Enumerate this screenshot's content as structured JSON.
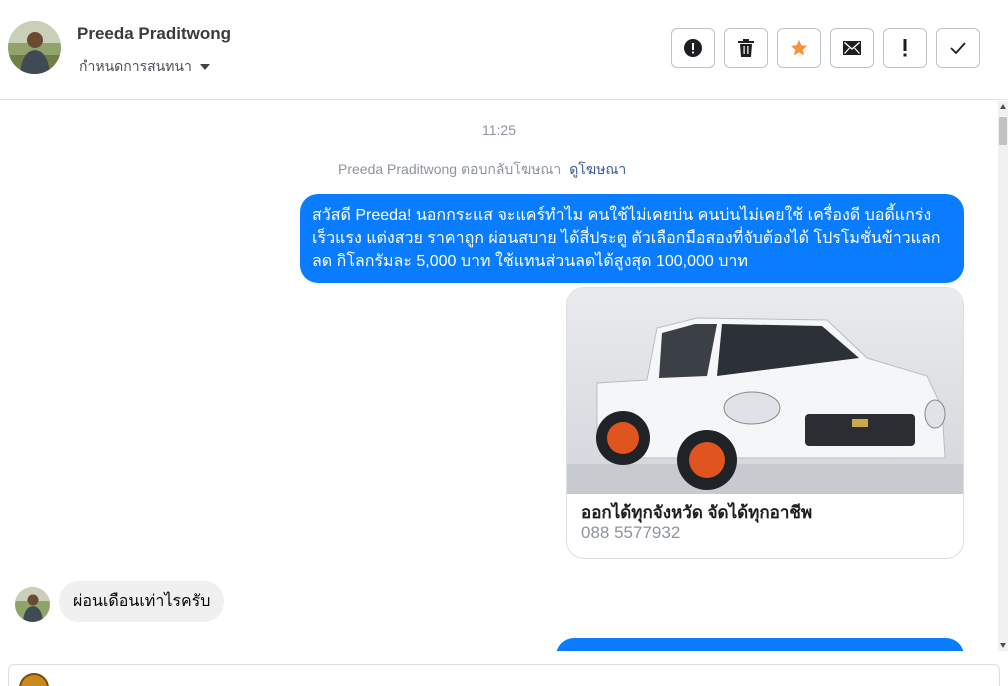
{
  "header": {
    "contact_name": "Preeda Praditwong",
    "conversation_label": "กำหนดการสนทนา",
    "actions": [
      {
        "icon": "alert-circle-icon",
        "name": "mark-spam-button"
      },
      {
        "icon": "trash-icon",
        "name": "delete-button"
      },
      {
        "icon": "star-icon",
        "name": "star-button"
      },
      {
        "icon": "envelope-icon",
        "name": "mark-unread-button"
      },
      {
        "icon": "exclamation-icon",
        "name": "follow-up-button"
      },
      {
        "icon": "check-icon",
        "name": "mark-done-button"
      }
    ]
  },
  "chat": {
    "timestamp": "11:25",
    "ad_reply_text": "Preeda Praditwong ตอบกลับโฆษณา",
    "view_ad_link": "ดูโฆษณา",
    "outgoing_message": "สวัสดี Preeda! นอกกระแส จะแคร์ทำไม คนใช้ไม่เคยบ่น คนบ่นไม่เคยใช้ เครื่องดี บอดี้แกร่ง เร็วแรง แต่งสวย ราคาถูก ผ่อนสบาย ได้สี่ประตู ตัวเลือกมือสองที่จับต้องได้ โปรโมชั่นข้าวแลกลด กิโลกรัมละ 5,000 บาท ใช้แทนส่วนลดได้สูงสุด 100,000 บาท",
    "card": {
      "title": "ออกได้ทุกจังหวัด จัดได้ทุกอาชีพ",
      "subtitle": "088 5577932"
    },
    "incoming_message": "ผ่อนเดือนเท่าไรครับ"
  },
  "colors": {
    "accent_blue": "#0a7cff",
    "star_orange": "#f7923b",
    "link_blue": "#385898"
  }
}
